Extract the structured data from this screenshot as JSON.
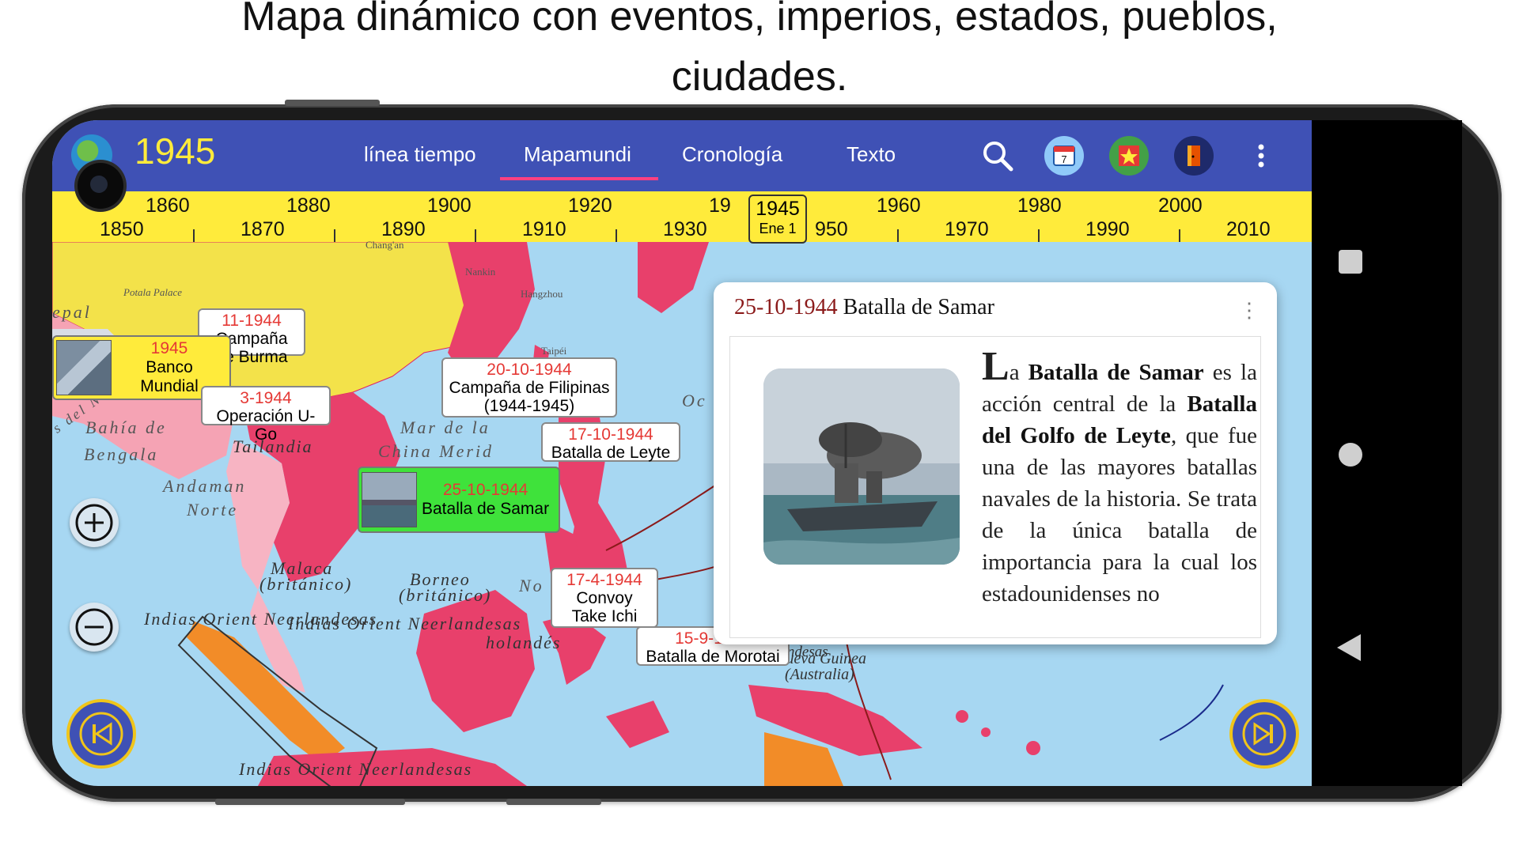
{
  "caption": {
    "line1": "Mapa dinámico con eventos, imperios, estados, pueblos,",
    "line2": "ciudades."
  },
  "app": {
    "year": "1945",
    "tabs": [
      "línea tiempo",
      "Mapamundi",
      "Cronología",
      "Texto"
    ],
    "active_tab": "Mapamundi",
    "icons": [
      "search-icon",
      "calendar-icon",
      "flag-icon",
      "door-icon",
      "more-vert-icon"
    ],
    "calendar_day": "7",
    "accent_color": "#3f51b5",
    "ruler_color": "#ffeb3b"
  },
  "ruler": {
    "upper": [
      "1860",
      "1880",
      "1900",
      "1920",
      "19",
      "1960",
      "1980",
      "2000"
    ],
    "lower": [
      "1850",
      "1870",
      "1890",
      "1910",
      "1930",
      "950",
      "1970",
      "1990",
      "2010"
    ],
    "marker_year": "1945",
    "marker_date": "Ene 1"
  },
  "map": {
    "labels": {
      "nepal": "epal",
      "potala": "Potala Palace",
      "changan": "Chang'an",
      "nankin": "Nankin",
      "hangzhou": "Hangzhou",
      "taipei": "Taipéi",
      "bahia1": "Bahía de",
      "bahia2": "Bengala",
      "tailandia": "Tailandia",
      "marchina1": "Mar de la",
      "marchina2": "China Merid",
      "andaman1": "Andaman",
      "andaman2": "Norte",
      "malaca1": "Malaca",
      "malaca2": "(británico)",
      "borneo1": "Borneo",
      "borneo2": "(británico)",
      "indias1": "Indias Orient Neerlandesas",
      "indias2": "Indias Orient Neerlandesas",
      "indias3": "Indias Orient Neerlandesas",
      "holandes": "holandés",
      "nuevaguinea1": "Nueva Guinea",
      "nuevaguinea2": "(Australia)",
      "oc": "Oc",
      "no": "No",
      "indiasorientales": "Indias Orientales Neerlandesas",
      "delnor": "s del Nor"
    },
    "events": [
      {
        "date": "11-1944",
        "title": "Campaña de Burma"
      },
      {
        "date": "1945",
        "title": "Banco Mundial"
      },
      {
        "date": "3-1944",
        "title": "Operación U-Go"
      },
      {
        "date": "20-10-1944",
        "title": "Campaña de Filipinas (1944-1945)"
      },
      {
        "date": "17-10-1944",
        "title": "Batalla de Leyte"
      },
      {
        "date": "25-10-1944",
        "title": "Batalla de Samar"
      },
      {
        "date": "17-4-1944",
        "title": "Convoy Take Ichi"
      },
      {
        "date": "15-9-1944",
        "title": "Batalla de Morotai"
      }
    ]
  },
  "card": {
    "date": "25-10-1944",
    "title": "Batalla de Samar",
    "text_dropcap": "L",
    "text_a": "a ",
    "text_b1": "Batalla de Samar",
    "text_c": " es la acción central de la ",
    "text_b2": "Batalla del Golfo de Leyte",
    "text_d": ", que fue una de las mayores batallas navales de la historia. Se trata de la única batalla de importancia para la cual los estadounidenses no"
  }
}
